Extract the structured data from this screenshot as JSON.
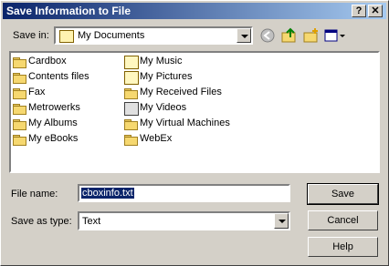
{
  "window": {
    "title": "Save Information to File"
  },
  "titlebar_buttons": {
    "help": "?",
    "close": "✕"
  },
  "toolbar": {
    "save_in_label": "Save in:",
    "save_in_value": "My Documents"
  },
  "files": [
    {
      "name": "Cardbox",
      "icon": "folder-icon"
    },
    {
      "name": "Contents files",
      "icon": "folder-icon"
    },
    {
      "name": "Fax",
      "icon": "folder-icon"
    },
    {
      "name": "Metrowerks",
      "icon": "folder-icon"
    },
    {
      "name": "My Albums",
      "icon": "folder-icon"
    },
    {
      "name": "My eBooks",
      "icon": "folder-icon"
    },
    {
      "name": "My Music",
      "icon": "music-folder-icon"
    },
    {
      "name": "My Pictures",
      "icon": "pictures-folder-icon"
    },
    {
      "name": "My Received Files",
      "icon": "folder-icon"
    },
    {
      "name": "My Videos",
      "icon": "video-folder-icon"
    },
    {
      "name": "My Virtual Machines",
      "icon": "folder-icon"
    },
    {
      "name": "WebEx",
      "icon": "folder-icon"
    }
  ],
  "form": {
    "file_name_label": "File name:",
    "file_name_value": "cboxinfo.txt",
    "save_as_type_label": "Save as type:",
    "save_as_type_value": "Text"
  },
  "buttons": {
    "save": "Save",
    "cancel": "Cancel",
    "help": "Help"
  }
}
